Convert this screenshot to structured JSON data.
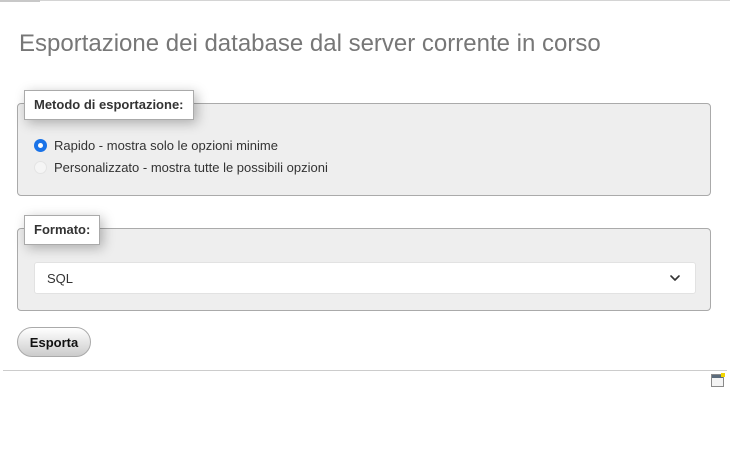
{
  "page": {
    "title": "Esportazione dei database dal server corrente in corso"
  },
  "export_method": {
    "legend": "Metodo di esportazione:",
    "options": [
      {
        "label": "Rapido - mostra solo le opzioni minime",
        "checked": true
      },
      {
        "label": "Personalizzato - mostra tutte le possibili opzioni",
        "checked": false
      }
    ]
  },
  "format": {
    "legend": "Formato:",
    "selected": "SQL"
  },
  "actions": {
    "export_label": "Esporta"
  },
  "icons": {
    "dropdown": "chevron-down-icon",
    "console": "console-toggle-icon"
  },
  "colors": {
    "radio_checked": "#1a73e8",
    "panel_background": "#eeeeee",
    "title_text": "#777777"
  }
}
